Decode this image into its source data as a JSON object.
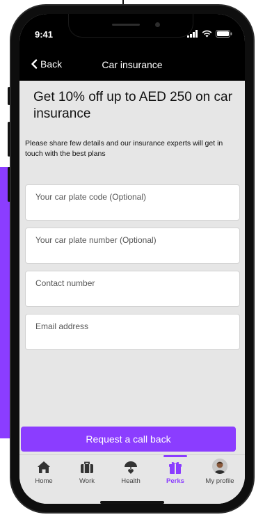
{
  "status_bar": {
    "time": "9:41",
    "icons": [
      "signal-icon",
      "wifi-icon",
      "battery-icon"
    ]
  },
  "nav": {
    "back_label": "Back",
    "title": "Car insurance"
  },
  "headline": "Get 10% off up to AED 250 on car insurance",
  "subtext": "Please share few details and our insurance experts will get in touch with the best plans",
  "form": {
    "fields": [
      {
        "placeholder": "Your car plate code (Optional)",
        "value": ""
      },
      {
        "placeholder": "Your car plate number (Optional)",
        "value": ""
      },
      {
        "placeholder": "Contact number",
        "value": ""
      },
      {
        "placeholder": "Email address",
        "value": ""
      }
    ]
  },
  "cta_label": "Request a call back",
  "tabs": [
    {
      "label": "Home",
      "icon": "home-icon",
      "active": false
    },
    {
      "label": "Work",
      "icon": "briefcase-icon",
      "active": false
    },
    {
      "label": "Health",
      "icon": "health-umbrella-icon",
      "active": false
    },
    {
      "label": "Perks",
      "icon": "gift-icon",
      "active": true
    },
    {
      "label": "My profile",
      "icon": "avatar",
      "active": false
    }
  ],
  "colors": {
    "accent": "#8b3dff",
    "background": "#e6e6e6",
    "header": "#000000"
  }
}
